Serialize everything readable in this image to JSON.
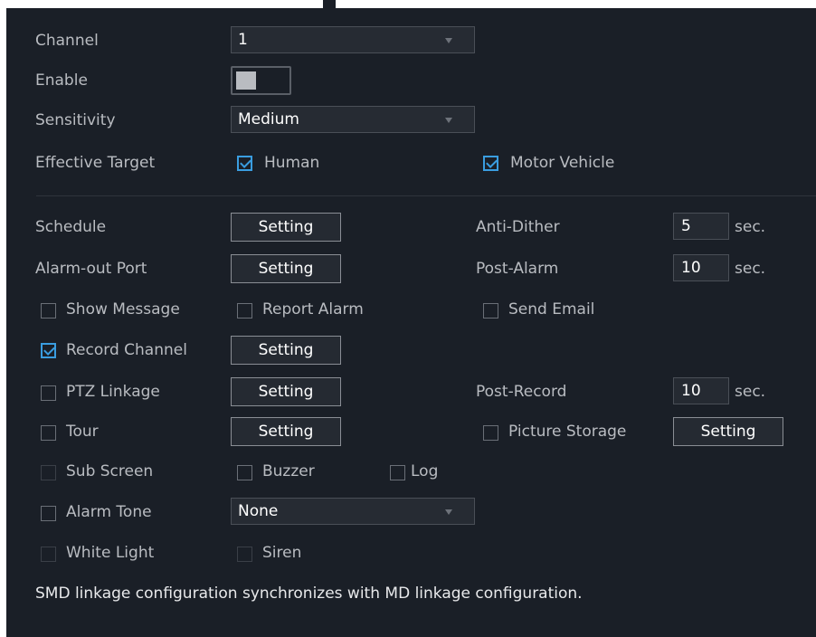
{
  "channel": {
    "label": "Channel",
    "value": "1"
  },
  "enable": {
    "label": "Enable",
    "on": true
  },
  "sensitivity": {
    "label": "Sensitivity",
    "value": "Medium"
  },
  "effective_target": {
    "label": "Effective Target",
    "human": "Human",
    "motor_vehicle": "Motor Vehicle"
  },
  "schedule": {
    "label": "Schedule",
    "button": "Setting"
  },
  "anti_dither": {
    "label": "Anti-Dither",
    "value": "5",
    "unit": "sec."
  },
  "alarm_out_port": {
    "label": "Alarm-out Port",
    "button": "Setting"
  },
  "post_alarm": {
    "label": "Post-Alarm",
    "value": "10",
    "unit": "sec."
  },
  "show_message": {
    "label": "Show Message"
  },
  "report_alarm": {
    "label": "Report Alarm"
  },
  "send_email": {
    "label": "Send Email"
  },
  "record_channel": {
    "label": "Record Channel",
    "button": "Setting"
  },
  "ptz_linkage": {
    "label": "PTZ Linkage",
    "button": "Setting"
  },
  "post_record": {
    "label": "Post-Record",
    "value": "10",
    "unit": "sec."
  },
  "tour": {
    "label": "Tour",
    "button": "Setting"
  },
  "picture_storage": {
    "label": "Picture Storage",
    "button": "Setting"
  },
  "sub_screen": {
    "label": "Sub Screen"
  },
  "buzzer": {
    "label": "Buzzer"
  },
  "log": {
    "label": "Log"
  },
  "alarm_tone": {
    "label": "Alarm Tone",
    "value": "None"
  },
  "white_light": {
    "label": "White Light"
  },
  "siren": {
    "label": "Siren"
  },
  "note": "SMD linkage configuration synchronizes with MD linkage configuration.",
  "colors": {
    "panel_bg": "#1a1f27",
    "accent": "#3a9de0",
    "text": "#b9bcc1"
  }
}
